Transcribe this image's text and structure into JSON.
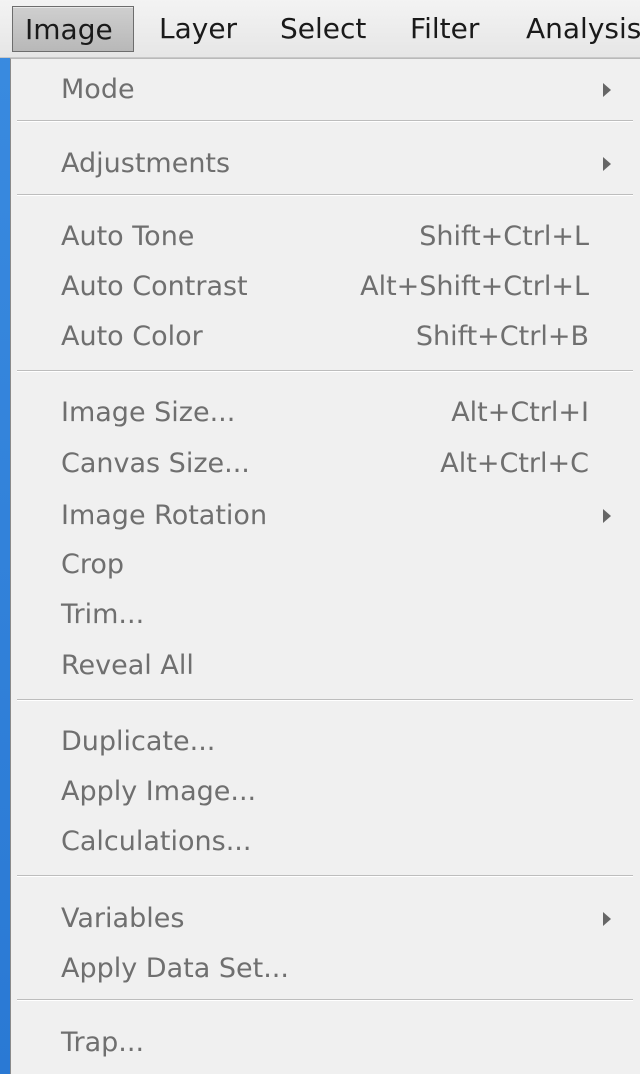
{
  "menubar": {
    "items": [
      {
        "label": "Image"
      },
      {
        "label": "Layer"
      },
      {
        "label": "Select"
      },
      {
        "label": "Filter"
      },
      {
        "label": "Analysis"
      }
    ]
  },
  "dropdown": {
    "items": [
      {
        "label": "Mode",
        "has_submenu": true
      },
      {
        "label": "Adjustments",
        "has_submenu": true
      },
      {
        "label": "Auto Tone",
        "shortcut": "Shift+Ctrl+L"
      },
      {
        "label": "Auto Contrast",
        "shortcut": "Alt+Shift+Ctrl+L"
      },
      {
        "label": "Auto Color",
        "shortcut": "Shift+Ctrl+B"
      },
      {
        "label": "Image Size...",
        "shortcut": "Alt+Ctrl+I"
      },
      {
        "label": "Canvas Size...",
        "shortcut": "Alt+Ctrl+C"
      },
      {
        "label": "Image Rotation",
        "has_submenu": true
      },
      {
        "label": "Crop"
      },
      {
        "label": "Trim..."
      },
      {
        "label": "Reveal All"
      },
      {
        "label": "Duplicate..."
      },
      {
        "label": "Apply Image..."
      },
      {
        "label": "Calculations..."
      },
      {
        "label": "Variables",
        "has_submenu": true
      },
      {
        "label": "Apply Data Set..."
      },
      {
        "label": "Trap..."
      }
    ]
  }
}
